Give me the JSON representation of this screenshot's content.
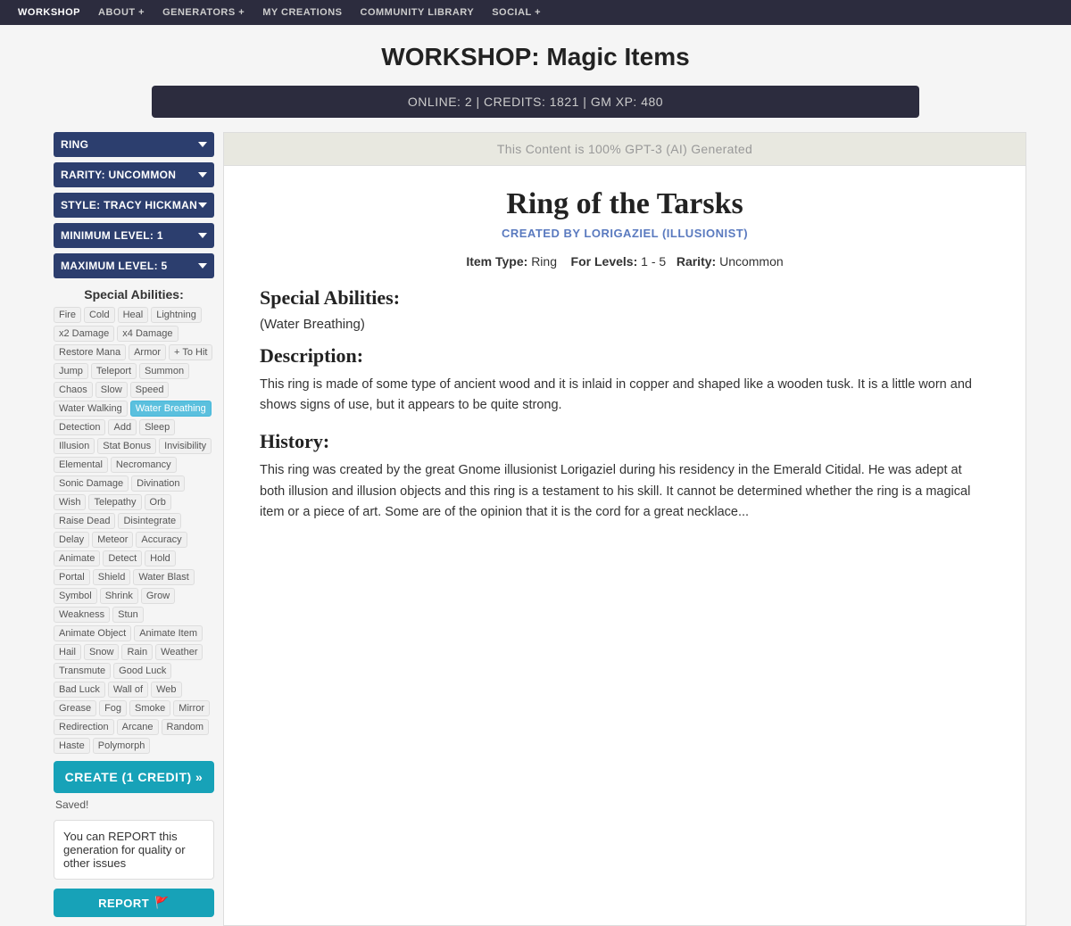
{
  "nav": {
    "items": [
      {
        "label": "WORKSHOP",
        "active": true
      },
      {
        "label": "ABOUT +",
        "active": false
      },
      {
        "label": "GENERATORS +",
        "active": false
      },
      {
        "label": "MY CREATIONS",
        "active": false
      },
      {
        "label": "COMMUNITY LIBRARY",
        "active": false
      },
      {
        "label": "SOCIAL +",
        "active": false
      }
    ]
  },
  "page_title": "WORKSHOP: Magic Items",
  "status_bar": "ONLINE: 2 | CREDITS: 1821 | GM XP: 480",
  "left_panel": {
    "type_label": "RING",
    "rarity_label": "RARITY: UNCOMMON",
    "style_label": "STYLE: TRACY HICKMAN",
    "min_level_label": "MINIMUM LEVEL: 1",
    "max_level_label": "MAXIMUM LEVEL: 5",
    "special_abilities_heading": "Special Abilities:",
    "abilities": [
      {
        "label": "Fire",
        "selected": false
      },
      {
        "label": "Cold",
        "selected": false
      },
      {
        "label": "Heal",
        "selected": false
      },
      {
        "label": "Lightning",
        "selected": false
      },
      {
        "label": "x2 Damage",
        "selected": false
      },
      {
        "label": "x4 Damage",
        "selected": false
      },
      {
        "label": "Restore Mana",
        "selected": false
      },
      {
        "label": "Armor",
        "selected": false
      },
      {
        "label": "+ To Hit",
        "selected": false
      },
      {
        "label": "Jump",
        "selected": false
      },
      {
        "label": "Teleport",
        "selected": false
      },
      {
        "label": "Summon",
        "selected": false
      },
      {
        "label": "Chaos",
        "selected": false
      },
      {
        "label": "Slow",
        "selected": false
      },
      {
        "label": "Speed",
        "selected": false
      },
      {
        "label": "Water Walking",
        "selected": false
      },
      {
        "label": "Water Breathing",
        "selected": true
      },
      {
        "label": "Detection",
        "selected": false
      },
      {
        "label": "Add",
        "selected": false
      },
      {
        "label": "Sleep",
        "selected": false
      },
      {
        "label": "Illusion",
        "selected": false
      },
      {
        "label": "Stat Bonus",
        "selected": false
      },
      {
        "label": "Invisibility",
        "selected": false
      },
      {
        "label": "Elemental",
        "selected": false
      },
      {
        "label": "Necromancy",
        "selected": false
      },
      {
        "label": "Sonic Damage",
        "selected": false
      },
      {
        "label": "Divination",
        "selected": false
      },
      {
        "label": "Wish",
        "selected": false
      },
      {
        "label": "Telepathy",
        "selected": false
      },
      {
        "label": "Orb",
        "selected": false
      },
      {
        "label": "Raise Dead",
        "selected": false
      },
      {
        "label": "Disintegrate",
        "selected": false
      },
      {
        "label": "Delay",
        "selected": false
      },
      {
        "label": "Meteor",
        "selected": false
      },
      {
        "label": "Accuracy",
        "selected": false
      },
      {
        "label": "Animate",
        "selected": false
      },
      {
        "label": "Detect",
        "selected": false
      },
      {
        "label": "Hold",
        "selected": false
      },
      {
        "label": "Portal",
        "selected": false
      },
      {
        "label": "Shield",
        "selected": false
      },
      {
        "label": "Water Blast",
        "selected": false
      },
      {
        "label": "Symbol",
        "selected": false
      },
      {
        "label": "Shrink",
        "selected": false
      },
      {
        "label": "Grow",
        "selected": false
      },
      {
        "label": "Weakness",
        "selected": false
      },
      {
        "label": "Stun",
        "selected": false
      },
      {
        "label": "Animate Object",
        "selected": false
      },
      {
        "label": "Animate Item",
        "selected": false
      },
      {
        "label": "Hail",
        "selected": false
      },
      {
        "label": "Snow",
        "selected": false
      },
      {
        "label": "Rain",
        "selected": false
      },
      {
        "label": "Weather",
        "selected": false
      },
      {
        "label": "Transmute",
        "selected": false
      },
      {
        "label": "Good Luck",
        "selected": false
      },
      {
        "label": "Bad Luck",
        "selected": false
      },
      {
        "label": "Wall of",
        "selected": false
      },
      {
        "label": "Web",
        "selected": false
      },
      {
        "label": "Grease",
        "selected": false
      },
      {
        "label": "Fog",
        "selected": false
      },
      {
        "label": "Smoke",
        "selected": false
      },
      {
        "label": "Mirror",
        "selected": false
      },
      {
        "label": "Redirection",
        "selected": false
      },
      {
        "label": "Arcane",
        "selected": false
      },
      {
        "label": "Random",
        "selected": false
      },
      {
        "label": "Haste",
        "selected": false
      },
      {
        "label": "Polymorph",
        "selected": false
      }
    ],
    "create_btn_label": "CREATE (1 CREDIT) »",
    "saved_text": "Saved!",
    "report_section_text": "You can REPORT this generation for quality or other issues",
    "report_btn_label": "REPORT"
  },
  "right_panel": {
    "ai_notice": "This Content is 100% GPT-3 (AI) Generated",
    "item_name": "Ring of the Tarsks",
    "creator_byline": "CREATED BY LORIGAZIEL (ILLUSIONIST)",
    "item_type_label": "Item Type:",
    "item_type_value": "Ring",
    "levels_label": "For Levels:",
    "levels_value": "1 - 5",
    "rarity_label": "Rarity:",
    "rarity_value": "Uncommon",
    "special_abilities_heading": "Special Abilities:",
    "special_abilities_text": "(Water Breathing)",
    "description_heading": "Description:",
    "description_text": "This ring is made of some type of ancient wood and it is inlaid in copper and shaped like a wooden tusk. It is a little worn and shows signs of use, but it appears to be quite strong.",
    "history_heading": "History:",
    "history_text": "This ring was created by the great Gnome illusionist Lorigaziel during his residency in the Emerald Citidal. He was adept at both illusion and illusion objects and this ring is a testament to his skill. It cannot be determined whether the ring is a magical item or a piece of art. Some are of the opinion that it is the cord for a great necklace..."
  }
}
